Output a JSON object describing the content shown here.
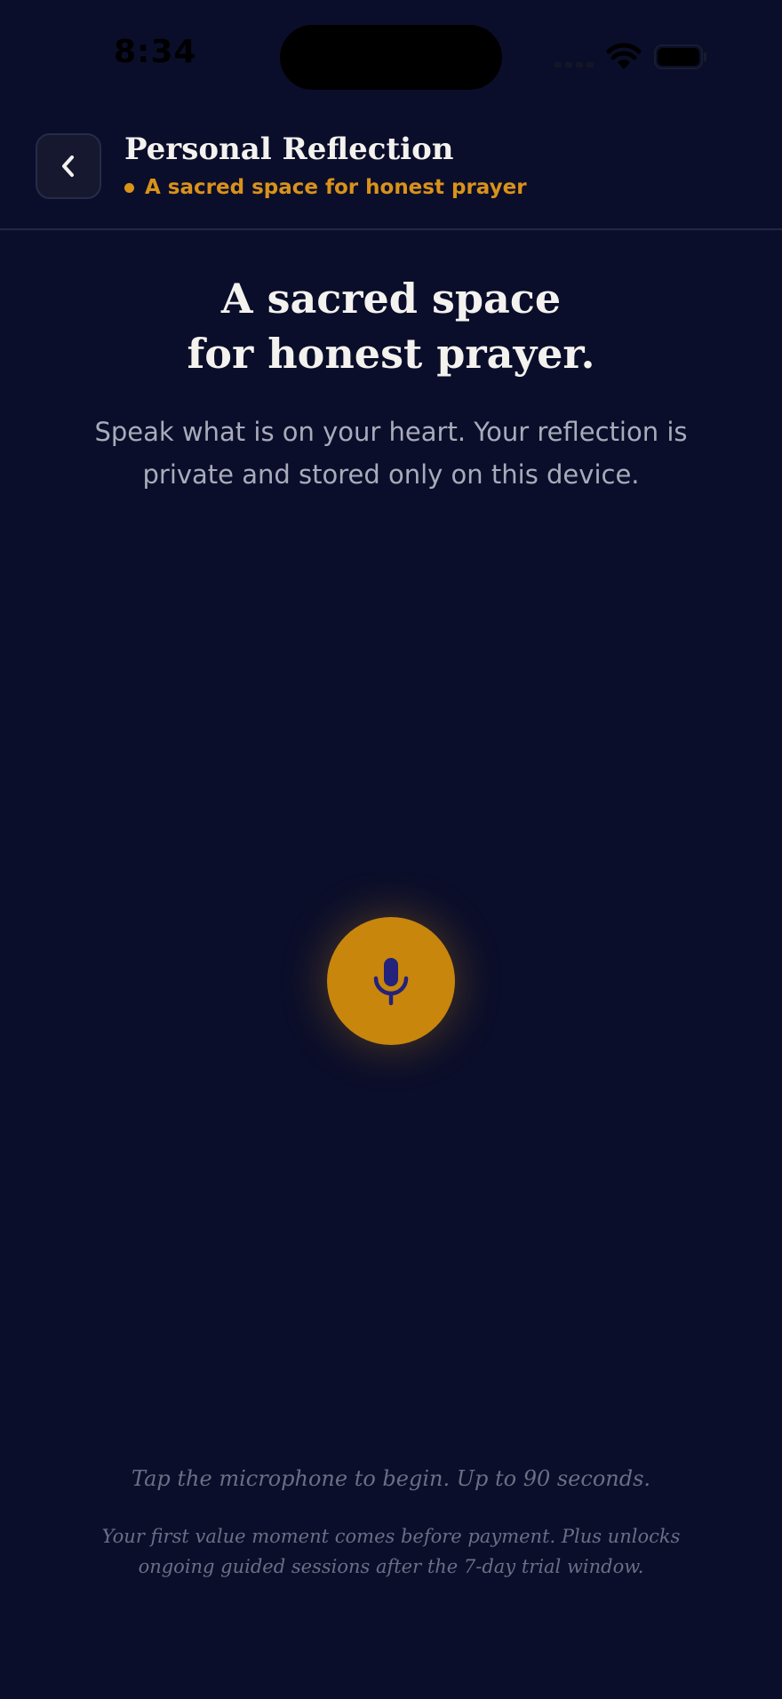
{
  "status_bar": {
    "time": "8:34",
    "icons": [
      "cell-signal-icon",
      "wifi-icon",
      "battery-icon"
    ]
  },
  "header": {
    "back_icon": "chevron-left-icon",
    "title": "Personal Reflection",
    "subtitle": "A sacred space for honest prayer"
  },
  "hero": {
    "title_line_1": "A sacred space",
    "title_line_2": "for honest prayer.",
    "body": "Speak what is on your heart. Your reflection is private and stored only on this device."
  },
  "mic": {
    "icon": "microphone-icon"
  },
  "footer": {
    "hint": "Tap the microphone to begin. Up to 90 seconds.",
    "note": "Your first value moment comes before payment. Plus unlocks ongoing guided sessions after the 7-day trial window."
  },
  "colors": {
    "background": "#0b0e2a",
    "accent": "#c8860c",
    "subtitle_accent": "#d9921a",
    "title_text": "#f4f2ee",
    "body_text": "#a9abbb",
    "muted_text": "#6b6e85",
    "divider": "#232747"
  }
}
